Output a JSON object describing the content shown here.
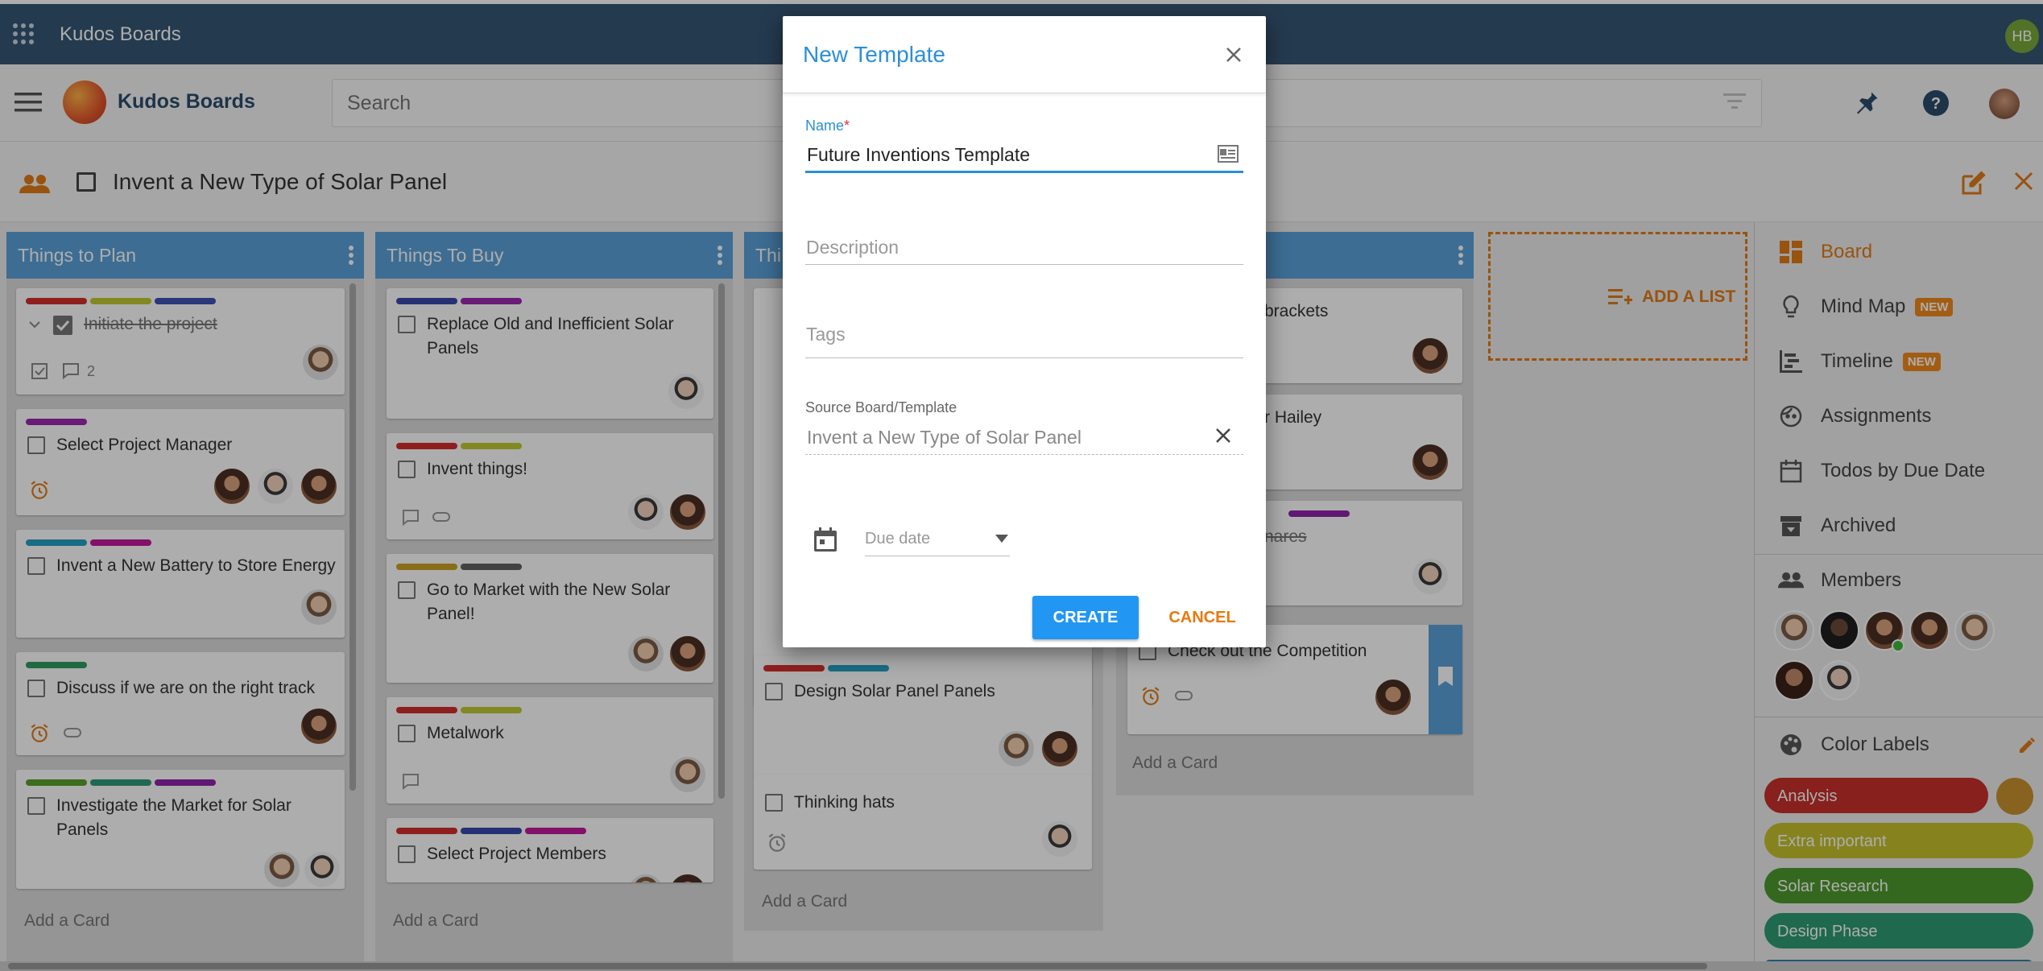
{
  "app": {
    "title": "Kudos Boards",
    "user_initials": "HB"
  },
  "header": {
    "brand": "Kudos Boards",
    "search_placeholder": "Search"
  },
  "board": {
    "title": "Invent a New Type of Solar Panel"
  },
  "lists": [
    {
      "title": "Things to Plan",
      "cards": [
        {
          "title": "Initiate the project",
          "labels": [
            "#d32f2f",
            "#c0ca33",
            "#3f51b5"
          ],
          "done": true,
          "comments": "2"
        },
        {
          "title": "Select Project Manager",
          "labels": [
            "#9c27b0"
          ]
        },
        {
          "title": "Invent a New Battery to Store Energy",
          "labels": [
            "#26a0c4",
            "#c2189b"
          ]
        },
        {
          "title": "Discuss if we are on the right track",
          "labels": [
            "#2e9b63"
          ]
        },
        {
          "title": "Investigate the Market for Solar Panels",
          "labels": [
            "#5aa02c",
            "#2e9b7d",
            "#8e24aa"
          ]
        }
      ],
      "add_card": "Add a Card"
    },
    {
      "title": "Things To Buy",
      "cards": [
        {
          "title": "Replace Old and Inefficient Solar Panels",
          "labels": [
            "#3949ab",
            "#9c27b0"
          ]
        },
        {
          "title": "Invent things!",
          "labels": [
            "#d32f2f",
            "#c0ca33"
          ]
        },
        {
          "title": "Go to Market with the New Solar Panel!",
          "labels": [
            "#c9a227",
            "#616161"
          ]
        },
        {
          "title": "Metalwork",
          "labels": [
            "#d32f2f",
            "#c0ca33"
          ]
        },
        {
          "title": "Select Project Members",
          "labels": [
            "#d32f2f",
            "#3949ab",
            "#c2189b"
          ]
        }
      ],
      "add_card": "Add a Card"
    },
    {
      "title": "Thi",
      "cards": [
        {
          "title": "Design Solar Panel Panels",
          "labels": [
            "#d32f2f",
            "#26a0c4"
          ]
        },
        {
          "title": "Thinking hats",
          "labels": []
        }
      ],
      "add_card": "Add a Card"
    },
    {
      "title": "",
      "cards": [
        {
          "title": "brackets"
        },
        {
          "title": "r Hailey"
        },
        {
          "title": "nares"
        },
        {
          "title": "Check out the Competition"
        }
      ],
      "add_card": "Add a Card"
    }
  ],
  "add_list": "ADD A LIST",
  "sidebar": {
    "items": [
      {
        "label": "Board",
        "icon": "board-icon",
        "active": true
      },
      {
        "label": "Mind Map",
        "icon": "lightbulb-icon",
        "badge": "NEW"
      },
      {
        "label": "Timeline",
        "icon": "timeline-icon",
        "badge": "NEW"
      },
      {
        "label": "Assignments",
        "icon": "face-icon"
      },
      {
        "label": "Todos by Due Date",
        "icon": "calendar-icon"
      },
      {
        "label": "Archived",
        "icon": "archive-icon"
      }
    ],
    "members_label": "Members",
    "color_labels_title": "Color Labels",
    "color_labels": [
      {
        "name": "Analysis",
        "color": "#c9302c"
      },
      {
        "name": "Extra important",
        "color": "#c6c22e"
      },
      {
        "name": "Solar Research",
        "color": "#4f9a2e"
      },
      {
        "name": "Design Phase",
        "color": "#2e9b75"
      }
    ]
  },
  "modal": {
    "title": "New Template",
    "name_label": "Name",
    "name_required": "*",
    "name_value": "Future Inventions Template",
    "description_placeholder": "Description",
    "tags_placeholder": "Tags",
    "source_label": "Source Board/Template",
    "source_value": "Invent a New Type of Solar Panel",
    "due_date_placeholder": "Due date",
    "create_label": "CREATE",
    "cancel_label": "CANCEL"
  },
  "colors": {
    "accent": "#2196f3",
    "cancel": "#e8790e",
    "topbar": "#355673",
    "list_header": "#5ba1d9"
  }
}
